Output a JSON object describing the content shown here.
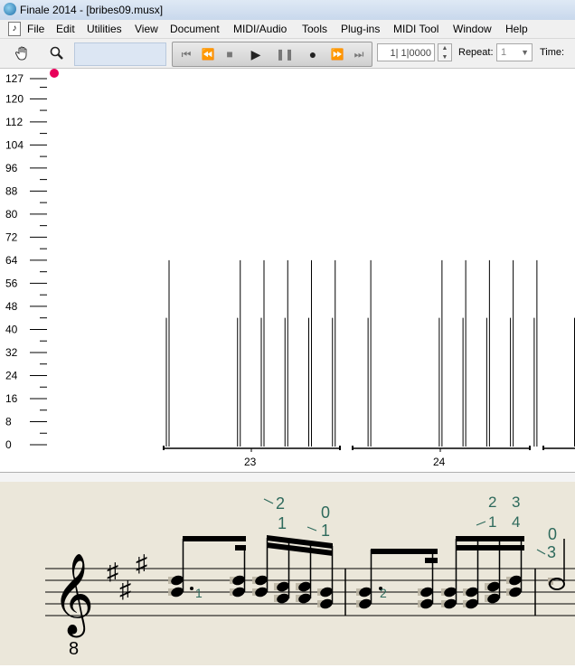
{
  "window": {
    "title": "Finale 2014 - [bribes09.musx]",
    "app_icon": "finale-logo-icon"
  },
  "menu": {
    "doc_icon": "document-music-icon",
    "items": [
      "File",
      "Edit",
      "Utilities",
      "View",
      "Document",
      "MIDI/Audio",
      "Tools",
      "Plug-ins",
      "MIDI Tool",
      "Window",
      "Help"
    ]
  },
  "toolbar": {
    "tools": [
      {
        "name": "hand-tool",
        "icon": "hand-icon"
      },
      {
        "name": "zoom-tool",
        "icon": "magnifier-icon"
      }
    ],
    "transport": [
      "rewind-to-start-icon",
      "rewind-icon",
      "stop-icon",
      "play-icon",
      "pause-icon",
      "record-icon",
      "fast-forward-icon",
      "fast-forward-to-end-icon"
    ],
    "counter": "1| 1|0000",
    "repeat_label": "Repeat:",
    "repeat_value": "1",
    "time_label": "Time:"
  },
  "velocity_editor": {
    "scale_labels": [
      "127",
      "120",
      "112",
      "104",
      "96",
      "88",
      "80",
      "72",
      "64",
      "56",
      "48",
      "40",
      "32",
      "24",
      "16",
      "8",
      "0"
    ],
    "scale_min": 0,
    "scale_max": 127,
    "measures": [
      "23",
      "24"
    ],
    "accent_color": "#e8005a",
    "note_velocities": [
      {
        "beat": 0.0,
        "values": [
          64,
          44
        ]
      },
      {
        "beat": 1.5,
        "values": [
          64,
          44
        ]
      },
      {
        "beat": 2.0,
        "values": [
          64,
          44
        ]
      },
      {
        "beat": 2.5,
        "values": [
          64,
          44
        ]
      },
      {
        "beat": 3.0,
        "values": [
          64,
          44
        ]
      },
      {
        "beat": 3.5,
        "values": [
          64,
          44
        ]
      },
      {
        "beat": 4.25,
        "values": [
          64,
          44
        ]
      },
      {
        "beat": 5.75,
        "values": [
          64,
          44
        ]
      },
      {
        "beat": 6.25,
        "values": [
          64,
          44
        ]
      },
      {
        "beat": 6.75,
        "values": [
          64,
          44
        ]
      },
      {
        "beat": 7.25,
        "values": [
          64,
          44
        ]
      },
      {
        "beat": 7.75,
        "values": [
          64,
          44
        ]
      },
      {
        "beat": 8.6,
        "values": [
          64,
          44
        ]
      }
    ]
  },
  "score": {
    "background": "#ebe7da",
    "fingering_color": "#2e6a5c",
    "clef": "treble-8vb",
    "clef_octave": "8",
    "fingerings": [
      {
        "text": "1",
        "cls": "below-note"
      },
      {
        "text": "2",
        "cls": "top"
      },
      {
        "text": "1",
        "cls": "mid"
      },
      {
        "text": "0",
        "cls": "top"
      },
      {
        "text": "1",
        "cls": "mid"
      },
      {
        "text": "2",
        "cls": "inline"
      },
      {
        "text": "2",
        "cls": "top"
      },
      {
        "text": "3",
        "cls": "top"
      },
      {
        "text": "1",
        "cls": "mid"
      },
      {
        "text": "4",
        "cls": "mid"
      },
      {
        "text": "0",
        "cls": "top"
      },
      {
        "text": "3",
        "cls": "mid"
      }
    ]
  }
}
